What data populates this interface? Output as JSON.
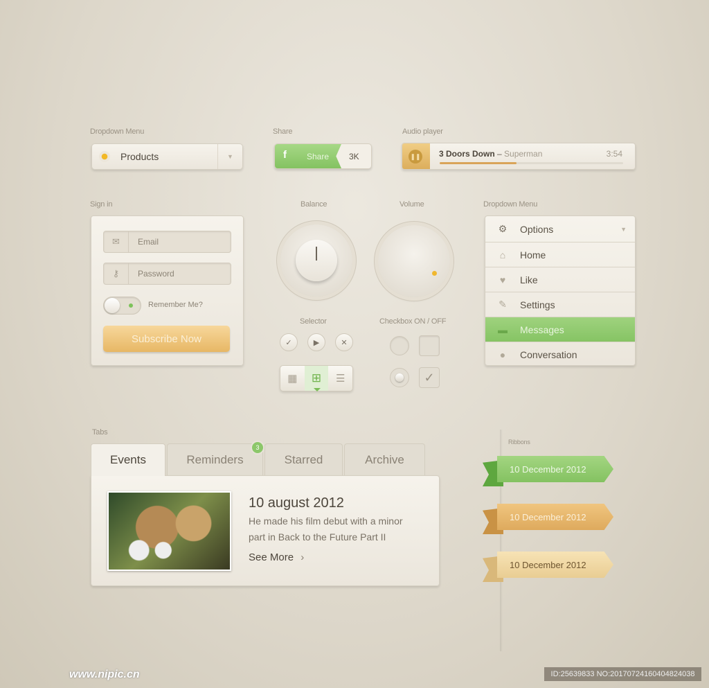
{
  "dropdown1": {
    "label": "Dropdown Menu",
    "value": "Products"
  },
  "share": {
    "label": "Share",
    "button": "Share",
    "count": "3K",
    "icon": "facebook-icon"
  },
  "audio": {
    "label": "Audio player",
    "artist": "3 Doors Down",
    "separator": " – ",
    "song": "Superman",
    "time": "3:54",
    "progress": 0.42
  },
  "signin": {
    "label": "Sign in",
    "email_placeholder": "Email",
    "password_placeholder": "Password",
    "remember": "Remember Me?",
    "remember_on": true,
    "submit": "Subscribe Now"
  },
  "balance": {
    "label": "Balance"
  },
  "volume": {
    "label": "Volume"
  },
  "selector": {
    "label": "Selector"
  },
  "checkbox": {
    "label": "Checkbox ON / OFF"
  },
  "dropdown2": {
    "label": "Dropdown Menu",
    "header": "Options",
    "items": [
      {
        "label": "Home",
        "icon": "home-icon"
      },
      {
        "label": "Like",
        "icon": "heart-icon"
      },
      {
        "label": "Settings",
        "icon": "wrench-icon"
      },
      {
        "label": "Messages",
        "icon": "mail-icon",
        "active": true
      },
      {
        "label": "Conversation",
        "icon": "chat-icon"
      }
    ]
  },
  "tabs": {
    "label": "Tabs",
    "items": [
      "Events",
      "Reminders",
      "Starred",
      "Archive"
    ],
    "badge": "3",
    "active": "Events"
  },
  "event": {
    "title": "10 august 2012",
    "text1": "He made his film debut with a minor",
    "text2": "part in Back to the Future Part II",
    "more": "See More"
  },
  "ribbons": {
    "label": "Ribbons",
    "items": [
      "10 December 2012",
      "10 December 2012",
      "10 December 2012"
    ]
  },
  "colors": {
    "green": "#8cc76a",
    "gold": "#e8b865",
    "bg": "#e3ded3"
  },
  "watermark": {
    "site": "www.nipic.cn",
    "id": "ID:25639833 NO:20170724160404824038"
  }
}
